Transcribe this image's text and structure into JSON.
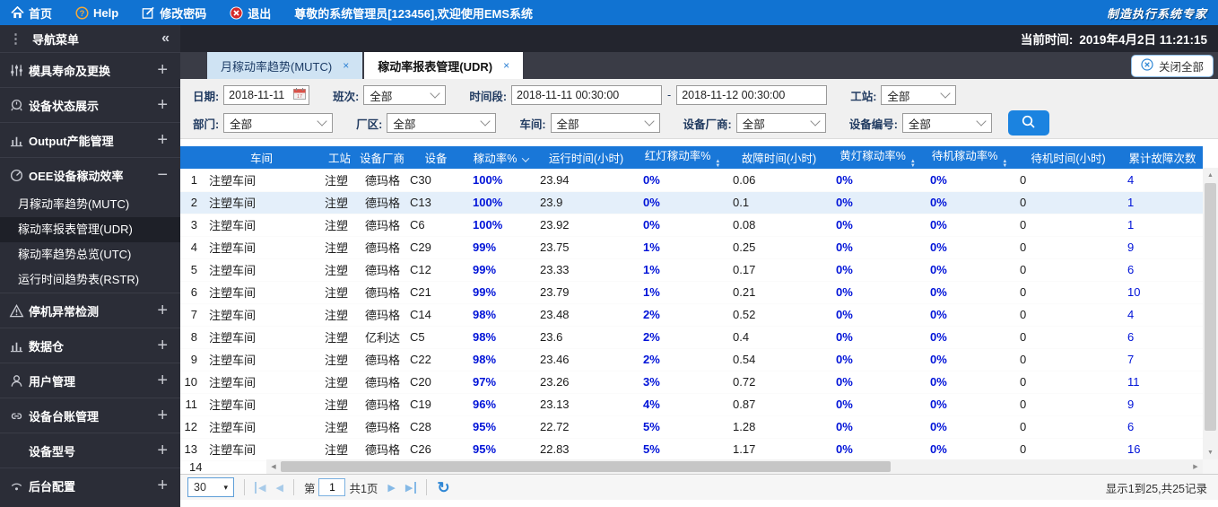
{
  "topbar": {
    "home": "首页",
    "help": "Help",
    "change_password": "修改密码",
    "logout": "退出",
    "welcome": "尊敬的系统管理员[123456],欢迎使用EMS系统",
    "brand": "制造执行系统专家"
  },
  "statusbar": {
    "current_time_label": "当前时间:",
    "current_time": "2019年4月2日 11:21:15"
  },
  "sidebar": {
    "title": "导航菜单",
    "collapse_icon": "«",
    "items": [
      {
        "label": "模具寿命及更换",
        "icon": "sliders-icon",
        "expander": "+"
      },
      {
        "label": "设备状态展示",
        "icon": "alarm-icon",
        "expander": "+"
      },
      {
        "label": "Output产能管理",
        "icon": "bar-chart-icon",
        "expander": "+"
      },
      {
        "label": "OEE设备稼动效率",
        "icon": "gauge-icon",
        "expander": "−",
        "expanded": true,
        "children": [
          {
            "label": "月稼动率趋势(MUTC)",
            "active": false
          },
          {
            "label": "稼动率报表管理(UDR)",
            "active": true
          },
          {
            "label": "稼动率趋势总览(UTC)",
            "active": false
          },
          {
            "label": "运行时间趋势表(RSTR)",
            "active": false
          }
        ]
      },
      {
        "label": "停机异常检测",
        "icon": "warning-icon",
        "expander": "+"
      },
      {
        "label": "数据仓",
        "icon": "bar-chart-icon",
        "expander": "+"
      },
      {
        "label": "用户管理",
        "icon": "user-icon",
        "expander": "+"
      },
      {
        "label": "设备台账管理",
        "icon": "link-icon",
        "expander": "+"
      },
      {
        "label": "设备型号",
        "icon": "none",
        "expander": "+"
      },
      {
        "label": "后台配置",
        "icon": "wifi-icon",
        "expander": "+"
      }
    ]
  },
  "tabs": {
    "close_glyph": "×",
    "list": [
      {
        "label": "月稼动率趋势(MUTC)",
        "active": false
      },
      {
        "label": "稼动率报表管理(UDR)",
        "active": true
      }
    ]
  },
  "close_all": {
    "label": "关闭全部"
  },
  "filters": {
    "date_label": "日期:",
    "date_value": "2018-11-11",
    "shift_label": "班次:",
    "shift_value": "全部",
    "timerange_label": "时间段:",
    "time_from": "2018-11-11 00:30:00",
    "time_separator": "-",
    "time_to": "2018-11-12 00:30:00",
    "station_label": "工站:",
    "station_value": "全部",
    "department_label": "部门:",
    "department_value": "全部",
    "plant_label": "厂区:",
    "plant_value": "全部",
    "workshop_label": "车间:",
    "workshop_value": "全部",
    "vendor_label": "设备厂商:",
    "vendor_value": "全部",
    "device_label": "设备编号:",
    "device_value": "全部"
  },
  "table": {
    "columns": [
      "车间",
      "工站",
      "设备厂商",
      "设备",
      "稼动率%",
      "运行时间(小时)",
      "红灯稼动率%",
      "故障时间(小时)",
      "黄灯稼动率%",
      "待机稼动率%",
      "待机时间(小时)",
      "累计故障次数"
    ],
    "sort": {
      "sorted_desc": "稼动率%",
      "sortable": [
        "红灯稼动率%",
        "黄灯稼动率%",
        "待机稼动率%"
      ]
    },
    "rows": [
      {
        "num": "1",
        "workshop": "注塑车间",
        "station": "注塑",
        "vendor": "德玛格",
        "device": "C30",
        "utilization": "100%",
        "runtime": "23.94",
        "red_rate": "0%",
        "fault_time": "0.06",
        "yellow_rate": "0%",
        "standby_rate": "0%",
        "standby_time": "0",
        "fault_count": "4",
        "selected": false
      },
      {
        "num": "2",
        "workshop": "注塑车间",
        "station": "注塑",
        "vendor": "德玛格",
        "device": "C13",
        "utilization": "100%",
        "runtime": "23.9",
        "red_rate": "0%",
        "fault_time": "0.1",
        "yellow_rate": "0%",
        "standby_rate": "0%",
        "standby_time": "0",
        "fault_count": "1",
        "selected": true
      },
      {
        "num": "3",
        "workshop": "注塑车间",
        "station": "注塑",
        "vendor": "德玛格",
        "device": "C6",
        "utilization": "100%",
        "runtime": "23.92",
        "red_rate": "0%",
        "fault_time": "0.08",
        "yellow_rate": "0%",
        "standby_rate": "0%",
        "standby_time": "0",
        "fault_count": "1",
        "selected": false
      },
      {
        "num": "4",
        "workshop": "注塑车间",
        "station": "注塑",
        "vendor": "德玛格",
        "device": "C29",
        "utilization": "99%",
        "runtime": "23.75",
        "red_rate": "1%",
        "fault_time": "0.25",
        "yellow_rate": "0%",
        "standby_rate": "0%",
        "standby_time": "0",
        "fault_count": "9",
        "selected": false
      },
      {
        "num": "5",
        "workshop": "注塑车间",
        "station": "注塑",
        "vendor": "德玛格",
        "device": "C12",
        "utilization": "99%",
        "runtime": "23.33",
        "red_rate": "1%",
        "fault_time": "0.17",
        "yellow_rate": "0%",
        "standby_rate": "0%",
        "standby_time": "0",
        "fault_count": "6",
        "selected": false
      },
      {
        "num": "6",
        "workshop": "注塑车间",
        "station": "注塑",
        "vendor": "德玛格",
        "device": "C21",
        "utilization": "99%",
        "runtime": "23.79",
        "red_rate": "1%",
        "fault_time": "0.21",
        "yellow_rate": "0%",
        "standby_rate": "0%",
        "standby_time": "0",
        "fault_count": "10",
        "selected": false
      },
      {
        "num": "7",
        "workshop": "注塑车间",
        "station": "注塑",
        "vendor": "德玛格",
        "device": "C14",
        "utilization": "98%",
        "runtime": "23.48",
        "red_rate": "2%",
        "fault_time": "0.52",
        "yellow_rate": "0%",
        "standby_rate": "0%",
        "standby_time": "0",
        "fault_count": "4",
        "selected": false
      },
      {
        "num": "8",
        "workshop": "注塑车间",
        "station": "注塑",
        "vendor": "亿利达",
        "device": "C5",
        "utilization": "98%",
        "runtime": "23.6",
        "red_rate": "2%",
        "fault_time": "0.4",
        "yellow_rate": "0%",
        "standby_rate": "0%",
        "standby_time": "0",
        "fault_count": "6",
        "selected": false
      },
      {
        "num": "9",
        "workshop": "注塑车间",
        "station": "注塑",
        "vendor": "德玛格",
        "device": "C22",
        "utilization": "98%",
        "runtime": "23.46",
        "red_rate": "2%",
        "fault_time": "0.54",
        "yellow_rate": "0%",
        "standby_rate": "0%",
        "standby_time": "0",
        "fault_count": "7",
        "selected": false
      },
      {
        "num": "10",
        "workshop": "注塑车间",
        "station": "注塑",
        "vendor": "德玛格",
        "device": "C20",
        "utilization": "97%",
        "runtime": "23.26",
        "red_rate": "3%",
        "fault_time": "0.72",
        "yellow_rate": "0%",
        "standby_rate": "0%",
        "standby_time": "0",
        "fault_count": "11",
        "selected": false
      },
      {
        "num": "11",
        "workshop": "注塑车间",
        "station": "注塑",
        "vendor": "德玛格",
        "device": "C19",
        "utilization": "96%",
        "runtime": "23.13",
        "red_rate": "4%",
        "fault_time": "0.87",
        "yellow_rate": "0%",
        "standby_rate": "0%",
        "standby_time": "0",
        "fault_count": "9",
        "selected": false
      },
      {
        "num": "12",
        "workshop": "注塑车间",
        "station": "注塑",
        "vendor": "德玛格",
        "device": "C28",
        "utilization": "95%",
        "runtime": "22.72",
        "red_rate": "5%",
        "fault_time": "1.28",
        "yellow_rate": "0%",
        "standby_rate": "0%",
        "standby_time": "0",
        "fault_count": "6",
        "selected": false
      },
      {
        "num": "13",
        "workshop": "注塑车间",
        "station": "注塑",
        "vendor": "德玛格",
        "device": "C26",
        "utilization": "95%",
        "runtime": "22.83",
        "red_rate": "5%",
        "fault_time": "1.17",
        "yellow_rate": "0%",
        "standby_rate": "0%",
        "standby_time": "0",
        "fault_count": "16",
        "selected": false
      }
    ],
    "partial_row_number": "14"
  },
  "pagination": {
    "page_size": "30",
    "page_label_prefix": "第",
    "page_value": "1",
    "page_label_suffix": "共1页",
    "record_info": "显示1到25,共25记录"
  },
  "colors": {
    "topbar_blue": "#1173d2",
    "sidebar_dark": "#2b2d37",
    "header_blue": "#1977d8",
    "value_blue": "#0013d8",
    "selected_row": "#e4effa",
    "search_button": "#1b83e0"
  }
}
